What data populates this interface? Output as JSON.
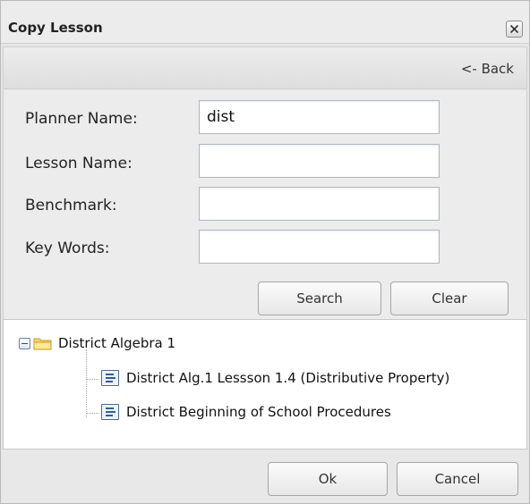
{
  "dialog": {
    "title": "Copy Lesson",
    "close_icon": "close-icon",
    "back_label": "<- Back"
  },
  "form": {
    "fields": [
      {
        "label": "Planner Name:",
        "value": "dist",
        "placeholder": ""
      },
      {
        "label": "Lesson Name:",
        "value": "",
        "placeholder": ""
      },
      {
        "label": "Benchmark:",
        "value": "",
        "placeholder": ""
      },
      {
        "label": "Key Words:",
        "value": "",
        "placeholder": ""
      }
    ],
    "search_label": "Search",
    "clear_label": "Clear"
  },
  "tree": {
    "folder": {
      "label": "District Algebra 1",
      "icon": "folder-icon",
      "expander_icon": "collapse-icon"
    },
    "items": [
      {
        "label": "District Alg.1 Lessson 1.4 (Distributive Property)",
        "icon": "lesson-icon"
      },
      {
        "label": "District Beginning of School Procedures",
        "icon": "lesson-icon"
      }
    ]
  },
  "footer": {
    "ok_label": "Ok",
    "cancel_label": "Cancel"
  }
}
